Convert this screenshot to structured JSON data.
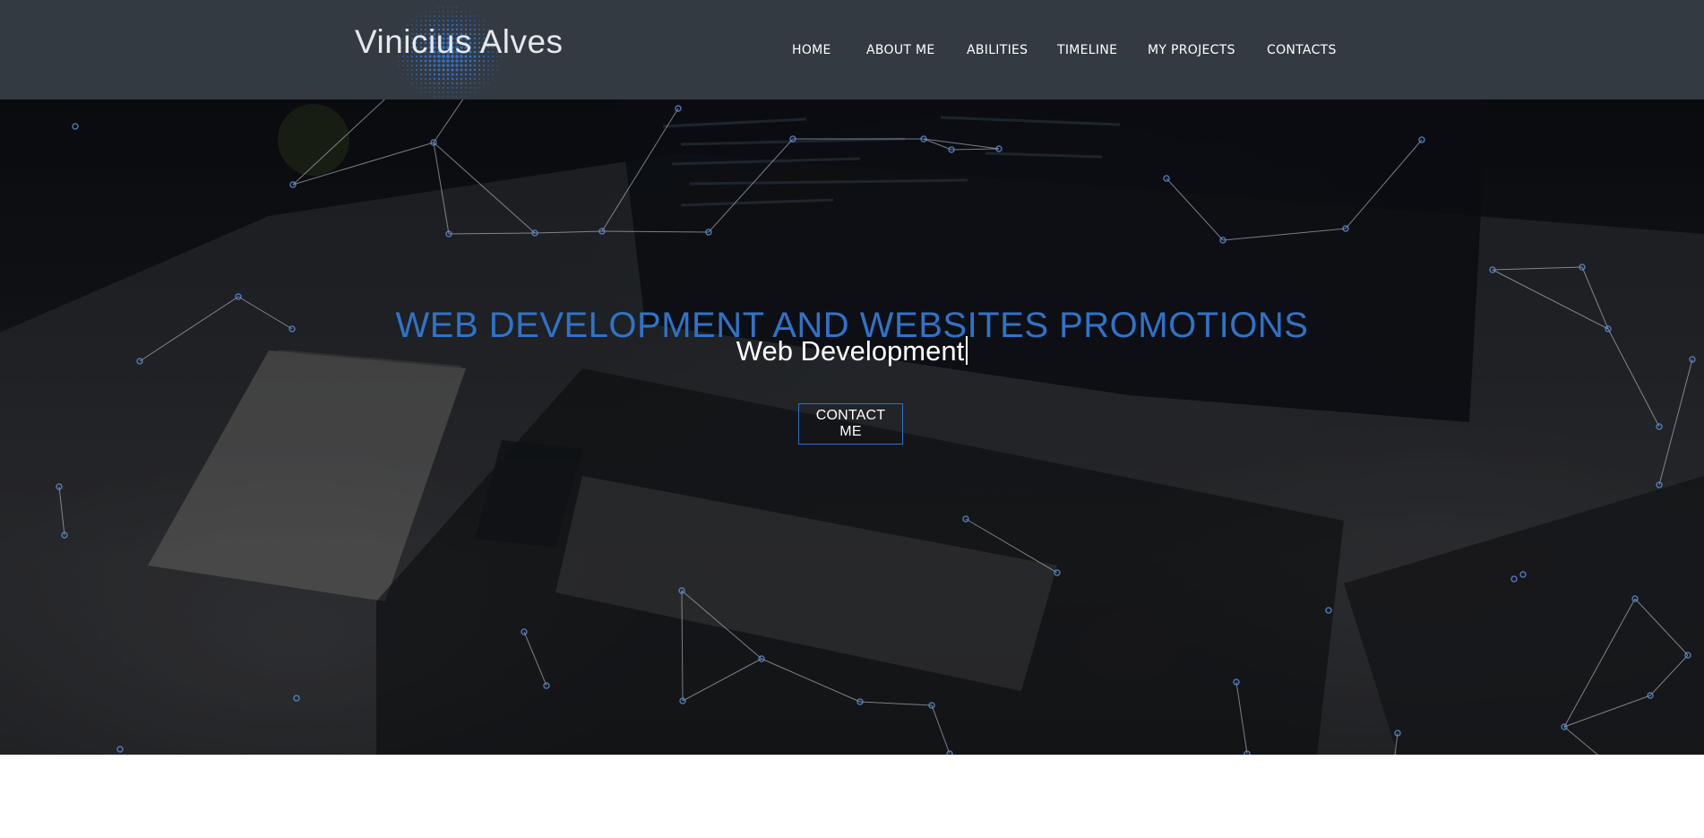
{
  "header": {
    "logo_text": "Vinicius Alves",
    "nav_items": [
      {
        "label": "HOME"
      },
      {
        "label": "ABOUT ME"
      },
      {
        "label": "ABILITIES"
      },
      {
        "label": "TIMELINE"
      },
      {
        "label": "MY PROJECTS"
      },
      {
        "label": "CONTACTS"
      }
    ]
  },
  "hero": {
    "title": "WEB DEVELOPMENT AND WEBSITES PROMOTIONS",
    "subtitle": "Web Development",
    "contact_button": "CONTACT ME"
  },
  "colors": {
    "navbar": "#343a42",
    "accent": "#2f73c9",
    "particles": "#5b8fd8"
  }
}
